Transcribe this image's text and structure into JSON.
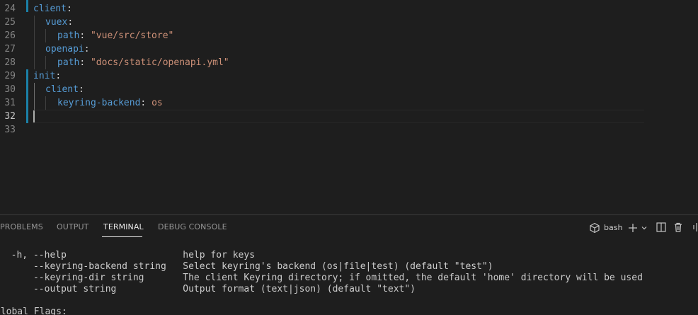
{
  "editor": {
    "line_numbers": [
      "24",
      "25",
      "26",
      "27",
      "28",
      "29",
      "30",
      "31",
      "32",
      "33"
    ],
    "lines": [
      {
        "key": "client",
        "colon": ":"
      },
      {
        "key": "vuex",
        "colon": ":"
      },
      {
        "key": "path",
        "colon": ": ",
        "value": "\"vue/src/store\""
      },
      {
        "key": "openapi",
        "colon": ":"
      },
      {
        "key": "path",
        "colon": ": ",
        "value": "\"docs/static/openapi.yml\""
      },
      {
        "key": "init",
        "colon": ":"
      },
      {
        "key": "client",
        "colon": ":"
      },
      {
        "key": "keyring-backend",
        "colon": ": ",
        "value": "os"
      }
    ]
  },
  "panel": {
    "tabs": [
      "PROBLEMS",
      "OUTPUT",
      "TERMINAL",
      "DEBUG CONSOLE"
    ],
    "active_tab": "TERMINAL",
    "shell_label": "bash",
    "icons": {
      "shell": "terminal-shell-icon",
      "add": "plus-icon",
      "dropdown": "chevron-down-icon",
      "split": "split-terminal-icon",
      "kill": "trash-icon"
    }
  },
  "terminal": {
    "lines": [
      "  -h, --help                     help for keys",
      "      --keyring-backend string   Select keyring's backend (os|file|test) (default \"test\")",
      "      --keyring-dir string       The client Keyring directory; if omitted, the default 'home' directory will be used",
      "      --output string            Output format (text|json) (default \"text\")",
      "",
      "Global Flags:"
    ]
  },
  "colors": {
    "background": "#1e1e1e",
    "key": "#569cd6",
    "string": "#ce9178",
    "line_number": "#858585",
    "modified_gutter": "#1b81a8"
  }
}
